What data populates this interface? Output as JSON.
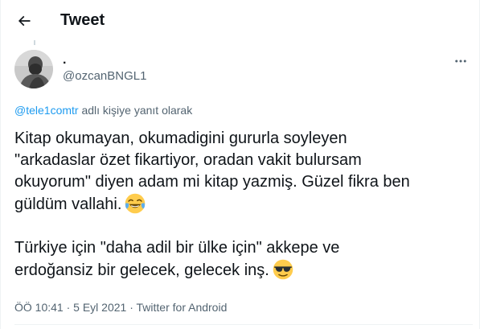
{
  "header": {
    "title": "Tweet",
    "back_icon": "arrow-left-icon"
  },
  "tweet": {
    "display_name": ".",
    "username": "@ozcanBNGL1",
    "more_icon": "more-horizontal-icon",
    "reply_context": {
      "handle": "@tele1comtr",
      "suffix": " adlı kişiye yanıt olarak"
    },
    "paragraphs": [
      {
        "lines": [
          "Kitap okumayan, okumadigini gururla soyleyen",
          "\"arkadaslar özet fikartiyor, oradan vakit bulursam",
          "okuyorum\" diyen adam mi kitap yazmiş. Güzel fikra ben",
          "güldüm vallahi."
        ],
        "emoji": "face-with-tears-of-joy"
      },
      {
        "lines": [
          "Türkiye için \"daha adil bir ülke için\" akkepe ve",
          "erdoğansiz bir gelecek, gelecek inş."
        ],
        "emoji": "smiling-face-with-sunglasses"
      }
    ],
    "time": "ÖÖ 10:41",
    "separator": " · ",
    "date": "5 Eyl 2021",
    "source": "Twitter for Android"
  },
  "colors": {
    "text": "#0f1419",
    "secondary": "#536471",
    "link": "#1d9bf0",
    "border": "#eff3f4",
    "emoji_yellow": "#ffcc4d"
  }
}
